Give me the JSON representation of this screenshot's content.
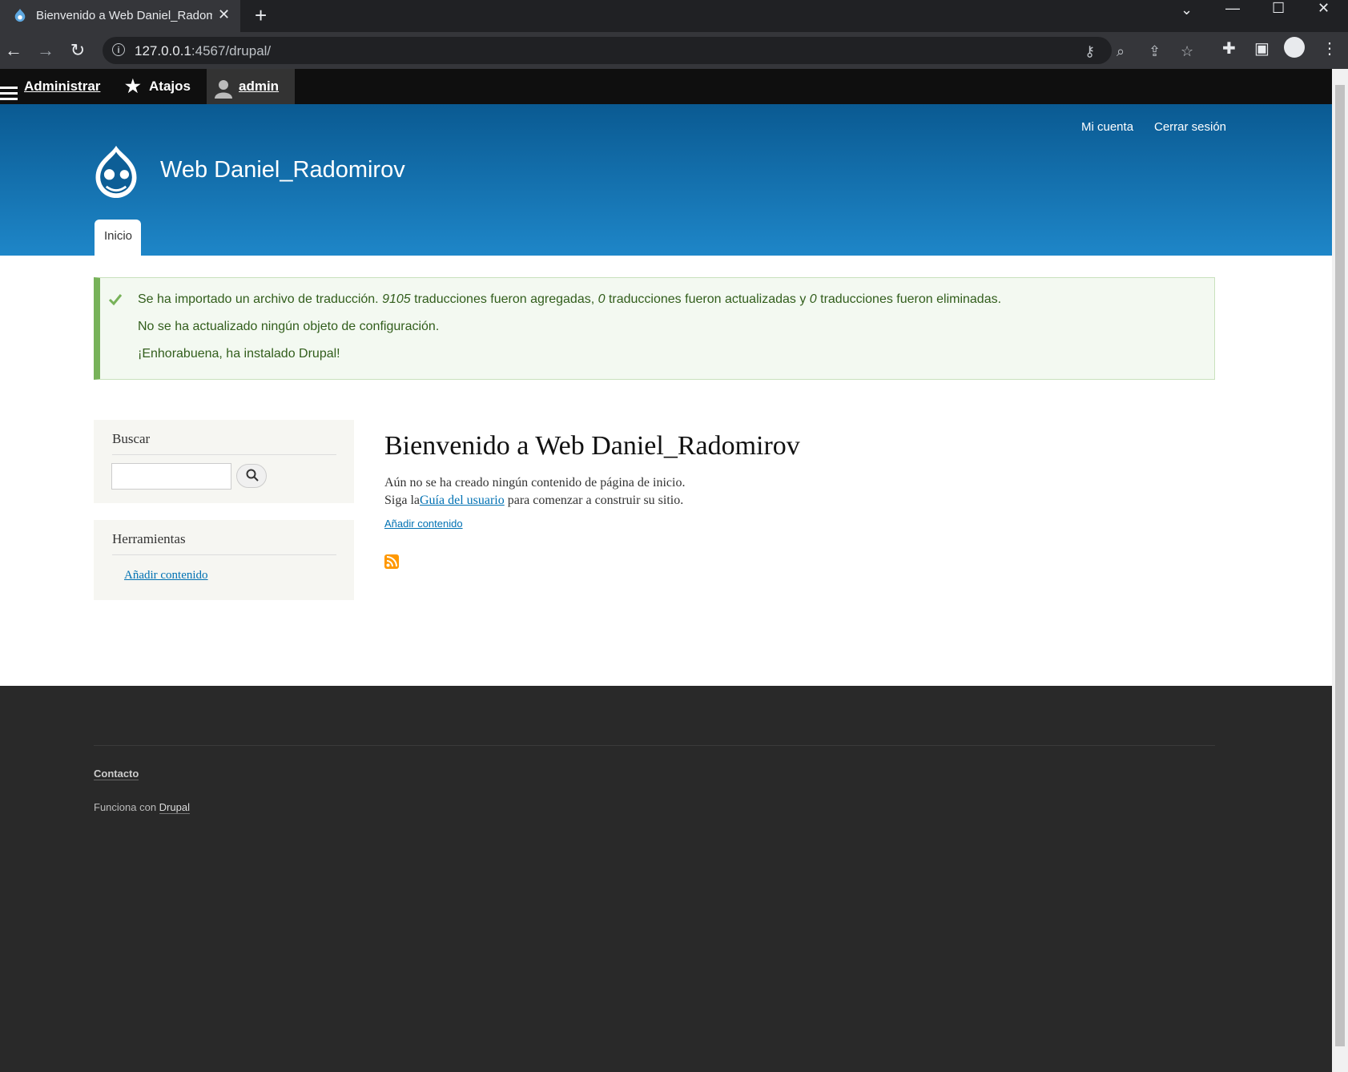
{
  "browser": {
    "tab_title": "Bienvenido a Web Daniel_Radom",
    "url_host": "127.0.0.1",
    "url_rest": ":4567/drupal/"
  },
  "adminbar": {
    "manage": "Administrar",
    "shortcuts": "Atajos",
    "user": "admin"
  },
  "header": {
    "my_account": "Mi cuenta",
    "logout": "Cerrar sesión",
    "site_name": "Web Daniel_Radomirov",
    "tab_home": "Inicio"
  },
  "messages": {
    "line1_a": "Se ha importado un archivo de traducción. ",
    "line1_n1": "9105",
    "line1_b": " traducciones fueron agregadas, ",
    "line1_n2": "0",
    "line1_c": " traducciones fueron actualizadas y ",
    "line1_n3": "0",
    "line1_d": " traducciones fueron eliminadas.",
    "line2": "No se ha actualizado ningún objeto de configuración.",
    "line3": "¡Enhorabuena, ha instalado Drupal!"
  },
  "sidebar": {
    "search_title": "Buscar",
    "tools_title": "Herramientas",
    "tools_link": "Añadir contenido"
  },
  "main": {
    "title": "Bienvenido a Web Daniel_Radomirov",
    "p1": "Aún no se ha creado ningún contenido de página de inicio.",
    "p2_a": "Siga la",
    "p2_link": "Guía del usuario",
    "p2_b": " para comenzar a construir su sitio.",
    "add_content": "Añadir contenido"
  },
  "footer": {
    "contact": "Contacto",
    "powered_a": "Funciona con ",
    "powered_link": "Drupal"
  },
  "colors": {
    "header_top": "#0a5a92",
    "header_bottom": "#1e86c8",
    "status_green": "#77b259",
    "link": "#0071b3"
  }
}
